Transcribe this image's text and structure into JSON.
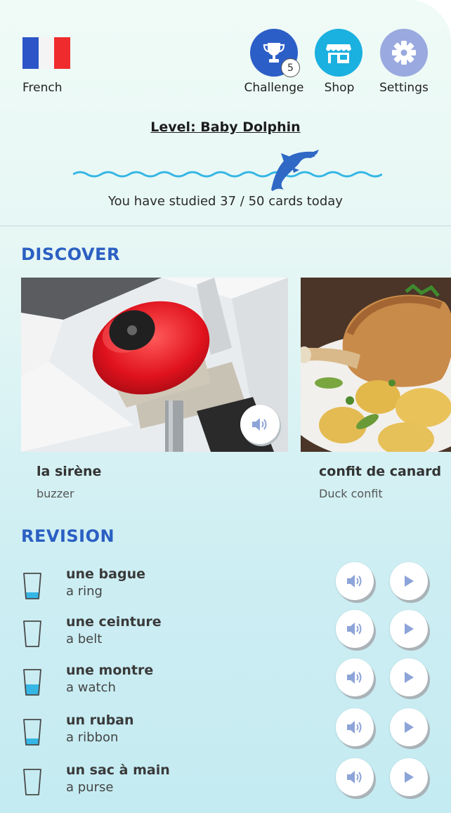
{
  "header": {
    "language": {
      "label": "French",
      "flag_colors": [
        "#2d55c8",
        "#f4f4f4",
        "#ef2b2d"
      ]
    },
    "buttons": [
      {
        "label": "Challenge",
        "icon": "trophy-icon",
        "color": "#2c5ec7",
        "badge": "5"
      },
      {
        "label": "Shop",
        "icon": "shop-icon",
        "color": "#1ab0e0"
      },
      {
        "label": "Settings",
        "icon": "gear-icon",
        "color": "#9aa9df"
      }
    ],
    "level_title": "Level: Baby Dolphin",
    "progress_text": "You have studied 37 / 50 cards today",
    "studied": 37,
    "goal": 50
  },
  "discover": {
    "title": "DISCOVER",
    "cards": [
      {
        "word": "la sirène",
        "translation": "buzzer",
        "image": "red-alarm-bell"
      },
      {
        "word": "confit de canard",
        "translation": "Duck confit",
        "image": "duck-confit-plate"
      }
    ]
  },
  "revision": {
    "title": "REVISION",
    "items": [
      {
        "word": "une bague",
        "translation": "a ring",
        "fill": 0.25
      },
      {
        "word": "une ceinture",
        "translation": "a belt",
        "fill": 0.0
      },
      {
        "word": "une montre",
        "translation": "a watch",
        "fill": 0.45
      },
      {
        "word": "un ruban",
        "translation": "a ribbon",
        "fill": 0.25
      },
      {
        "word": "un sac à main",
        "translation": "a purse",
        "fill": 0.0
      }
    ]
  },
  "colors": {
    "accent": "#2b5fc2",
    "water": "#35b6e5",
    "icon_button": "#8da4d8"
  }
}
